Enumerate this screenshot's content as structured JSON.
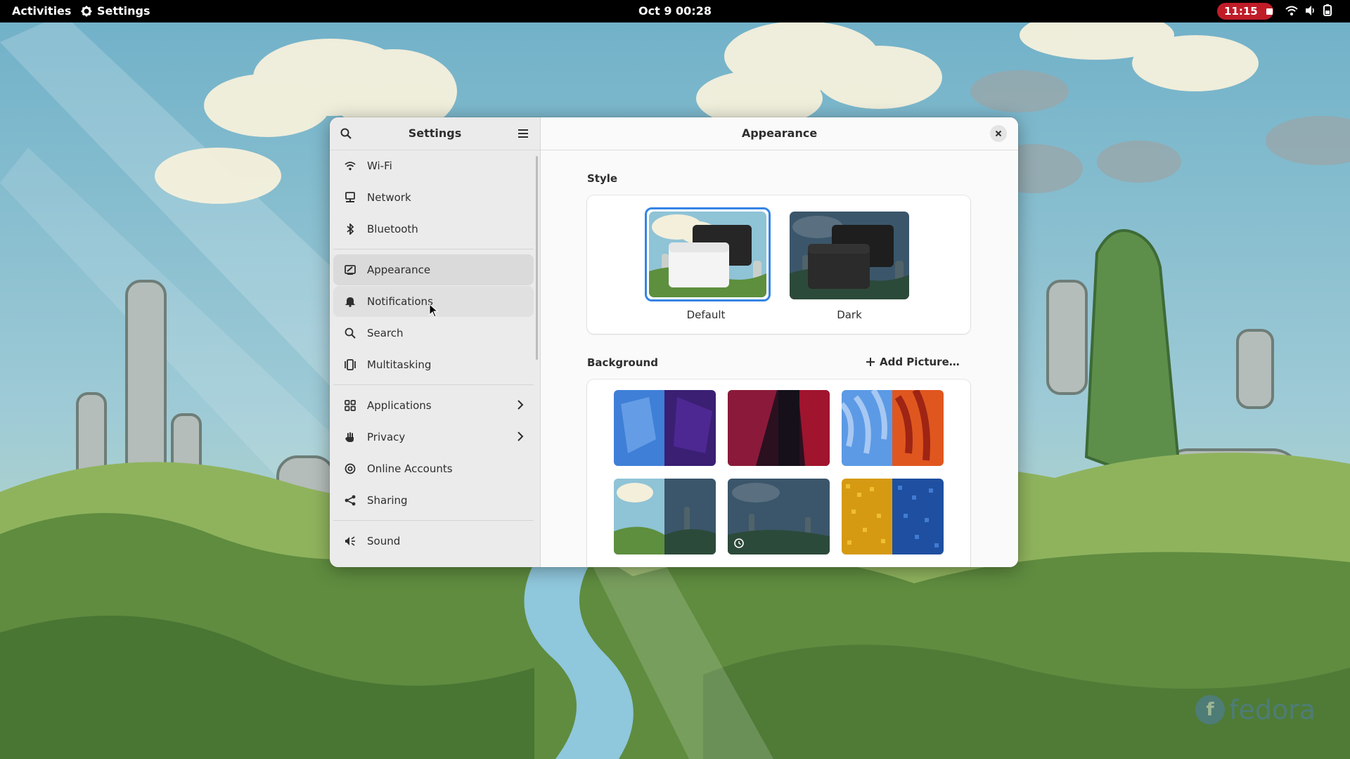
{
  "topbar": {
    "activities": "Activities",
    "app_name": "Settings",
    "clock": "Oct 9  00:28",
    "recording_time": "11:15"
  },
  "window": {
    "sidebar_title": "Settings",
    "content_title": "Appearance",
    "sidebar_items": [
      {
        "label": "Wi-Fi",
        "icon": "wifi-icon"
      },
      {
        "label": "Network",
        "icon": "network-icon"
      },
      {
        "label": "Bluetooth",
        "icon": "bluetooth-icon"
      },
      {
        "label": "Appearance",
        "icon": "appearance-icon",
        "selected": true
      },
      {
        "label": "Notifications",
        "icon": "bell-icon"
      },
      {
        "label": "Search",
        "icon": "search-icon"
      },
      {
        "label": "Multitasking",
        "icon": "multitasking-icon"
      },
      {
        "label": "Applications",
        "icon": "grid-icon",
        "has_submenu": true
      },
      {
        "label": "Privacy",
        "icon": "hand-icon",
        "has_submenu": true
      },
      {
        "label": "Online Accounts",
        "icon": "at-icon"
      },
      {
        "label": "Sharing",
        "icon": "share-icon"
      },
      {
        "label": "Sound",
        "icon": "speaker-icon"
      }
    ],
    "style": {
      "label": "Style",
      "options": [
        {
          "label": "Default",
          "selected": true
        },
        {
          "label": "Dark",
          "selected": false
        }
      ]
    },
    "background": {
      "label": "Background",
      "add_button": "Add Picture…"
    }
  },
  "colors": {
    "accent": "#3584e4",
    "record": "#c01c28"
  },
  "watermark": "fedora"
}
